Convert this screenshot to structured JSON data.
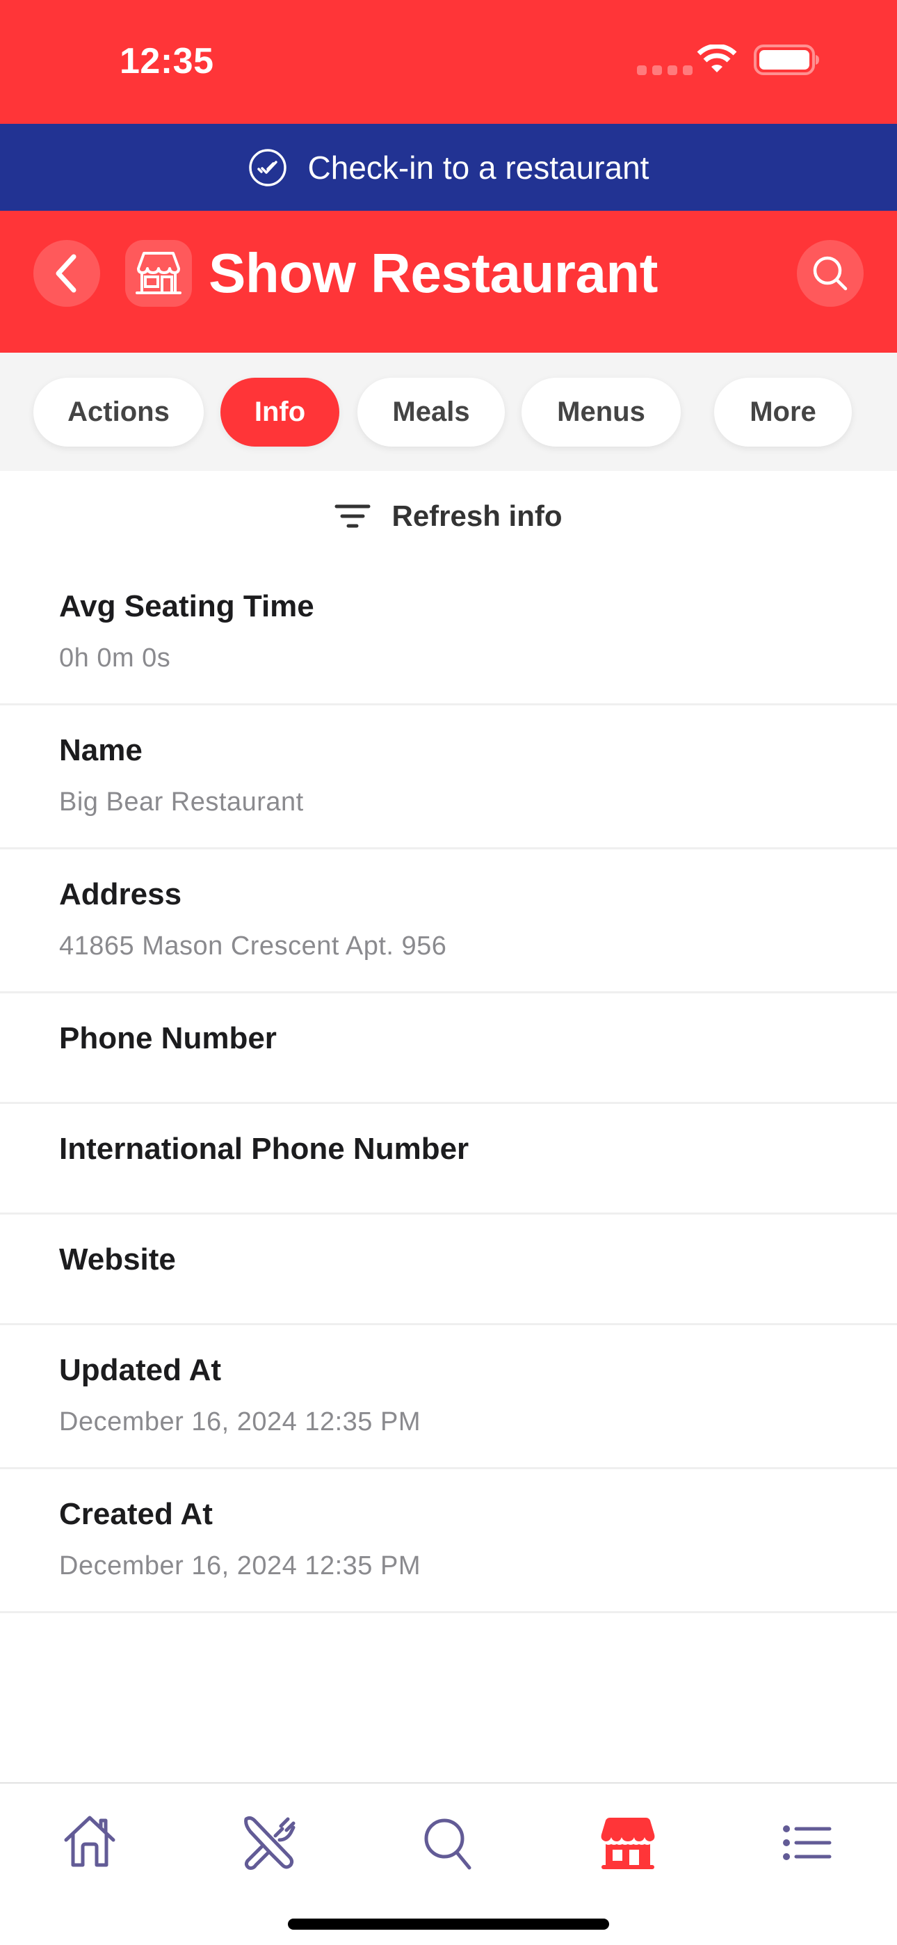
{
  "status_bar": {
    "time": "12:35"
  },
  "checkin_banner": {
    "label": "Check-in to a restaurant",
    "icon": "check-circle-icon"
  },
  "header": {
    "title": "Show Restaurant",
    "back_icon": "chevron-left-icon",
    "store_icon": "storefront-icon",
    "search_icon": "search-icon"
  },
  "tabs": [
    {
      "label": "Actions",
      "active": false
    },
    {
      "label": "Info",
      "active": true
    },
    {
      "label": "Meals",
      "active": false
    },
    {
      "label": "Menus",
      "active": false
    },
    {
      "label": "More",
      "active": false
    }
  ],
  "refresh": {
    "label": "Refresh info",
    "icon": "filter-icon"
  },
  "info_rows": [
    {
      "label": "Avg Seating Time",
      "value": "0h 0m 0s"
    },
    {
      "label": "Name",
      "value": "Big Bear Restaurant"
    },
    {
      "label": "Address",
      "value": "41865 Mason Crescent Apt. 956"
    },
    {
      "label": "Phone Number",
      "value": ""
    },
    {
      "label": "International Phone Number",
      "value": ""
    },
    {
      "label": "Website",
      "value": ""
    },
    {
      "label": "Updated At",
      "value": "December 16, 2024 12:35 PM"
    },
    {
      "label": "Created At",
      "value": "December 16, 2024 12:35 PM"
    }
  ],
  "bottom_tabs": [
    {
      "name": "home",
      "icon": "home-icon",
      "active": false
    },
    {
      "name": "meals",
      "icon": "fork-knife-icon",
      "active": false
    },
    {
      "name": "search",
      "icon": "search-icon",
      "active": false
    },
    {
      "name": "restaurants",
      "icon": "storefront-icon",
      "active": true
    },
    {
      "name": "list",
      "icon": "list-icon",
      "active": false
    }
  ],
  "colors": {
    "primary_red": "#FF3538",
    "banner_blue": "#223393",
    "tab_inactive": "#625B96",
    "tab_strip_bg": "#F4F4F4",
    "value_gray": "#8A8A8E"
  }
}
